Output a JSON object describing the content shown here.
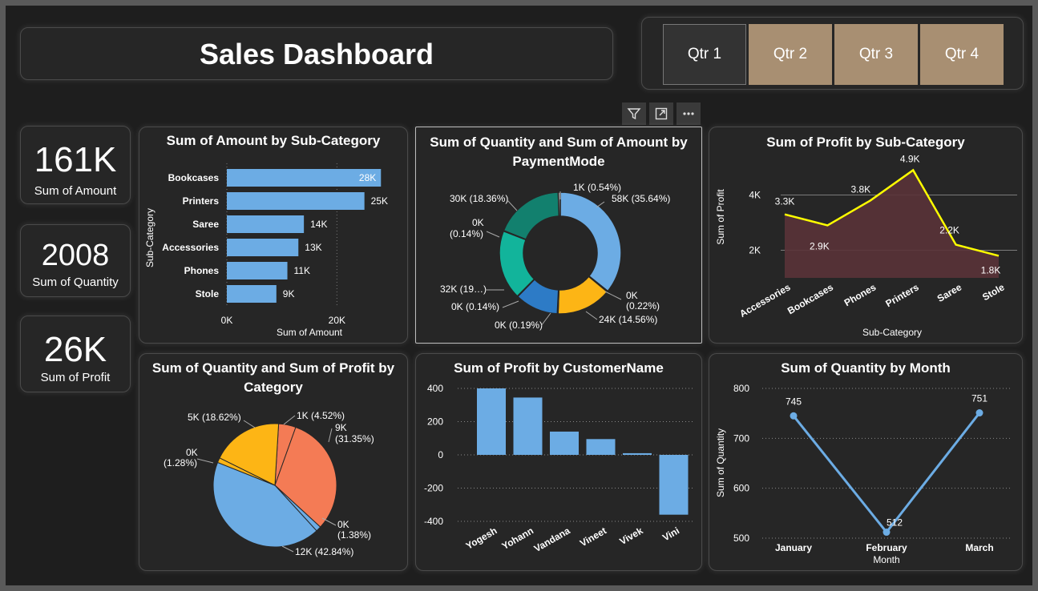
{
  "header": {
    "title": "Sales Dashboard"
  },
  "quarters": [
    {
      "label": "Qtr 1",
      "active": true
    },
    {
      "label": "Qtr 2",
      "active": false
    },
    {
      "label": "Qtr 3",
      "active": false
    },
    {
      "label": "Qtr 4",
      "active": false
    }
  ],
  "kpis": [
    {
      "value": "161K",
      "label": "Sum of Amount"
    },
    {
      "value": "2008",
      "label": "Sum of Quantity"
    },
    {
      "value": "26K",
      "label": "Sum of Profit"
    }
  ],
  "toolbar": {
    "filter_icon": "filter-icon",
    "focus_icon": "focus-mode-icon",
    "more_icon": "more-options-icon"
  },
  "colors": {
    "bar": "#6CACE4",
    "line_yellow": "#FFFF00",
    "area_fill": "#5a3338",
    "pie_blue": "#6CACE4",
    "pie_orange": "#F47B55",
    "pie_yellow": "#FDB515",
    "donut_teal_dark": "#12806E",
    "donut_teal": "#12B49B",
    "donut_blue": "#2D7BC6",
    "donut_yellow": "#FDB515",
    "qtr_inactive": "#a88f72"
  },
  "chart_data": [
    {
      "id": "amount_by_subcat",
      "type": "bar",
      "orientation": "horizontal",
      "title": "Sum of Amount by Sub-Category",
      "xlabel": "Sum of Amount",
      "ylabel": "Sub-Category",
      "categories": [
        "Bookcases",
        "Printers",
        "Saree",
        "Accessories",
        "Phones",
        "Stole"
      ],
      "values": [
        28000,
        25000,
        14000,
        13000,
        11000,
        9000
      ],
      "data_labels": [
        "28K",
        "25K",
        "14K",
        "13K",
        "11K",
        "9K"
      ],
      "xticks": [
        "0K",
        "20K"
      ],
      "xlim": [
        0,
        30000
      ]
    },
    {
      "id": "qty_amount_by_payment",
      "type": "pie",
      "variant": "donut",
      "title": "Sum of Quantity and Sum of Amount by PaymentMode",
      "slices": [
        {
          "value": 35.64,
          "label": "58K (35.64%)",
          "color": "#6CACE4"
        },
        {
          "value": 0.22,
          "label": "0K (0.22%)",
          "color": "#9a8a6a"
        },
        {
          "value": 14.56,
          "label": "24K (14.56%)",
          "color": "#FDB515"
        },
        {
          "value": 0.19,
          "label": "0K (0.19%)",
          "color": "#8a6fb0"
        },
        {
          "value": 11.5,
          "label": "",
          "color": "#2D7BC6"
        },
        {
          "value": 0.14,
          "label": "0K (0.14%)",
          "color": "#c0506a"
        },
        {
          "value": 18.36,
          "label": "32K (19…)",
          "color": "#12B49B"
        },
        {
          "value": 0.14,
          "label": "0K (0.14%)",
          "color": "#888888"
        },
        {
          "value": 18.36,
          "label": "30K (18.36%)",
          "color": "#12806E"
        },
        {
          "value": 0.54,
          "label": "1K (0.54%)",
          "color": "#aaaaaa"
        }
      ]
    },
    {
      "id": "profit_by_subcat",
      "type": "area",
      "title": "Sum of Profit by Sub-Category",
      "xlabel": "Sub-Category",
      "ylabel": "Sum of Profit",
      "categories": [
        "Accessories",
        "Bookcases",
        "Phones",
        "Printers",
        "Saree",
        "Stole"
      ],
      "values": [
        3300,
        2900,
        3800,
        4900,
        2200,
        1800
      ],
      "data_labels": [
        "3.3K",
        "2.9K",
        "3.8K",
        "4.9K",
        "2.2K",
        "1.8K"
      ],
      "yticks": [
        "2K",
        "4K"
      ],
      "ylim": [
        1000,
        5000
      ]
    },
    {
      "id": "qty_profit_by_category",
      "type": "pie",
      "title": "Sum of Quantity and Sum of Profit by Category",
      "slices": [
        {
          "value": 4.52,
          "label": "1K (4.52%)",
          "color": "#F47B55"
        },
        {
          "value": 31.35,
          "label": "9K (31.35%)",
          "color": "#F47B55"
        },
        {
          "value": 1.38,
          "label": "0K (1.38%)",
          "color": "#6CACE4"
        },
        {
          "value": 42.84,
          "label": "12K (42.84%)",
          "color": "#6CACE4"
        },
        {
          "value": 1.28,
          "label": "0K (1.28%)",
          "color": "#FDB515"
        },
        {
          "value": 18.62,
          "label": "5K (18.62%)",
          "color": "#FDB515"
        }
      ]
    },
    {
      "id": "profit_by_customer",
      "type": "bar",
      "title": "Sum of Profit by CustomerName",
      "categories": [
        "Yogesh",
        "Yohann",
        "Vandana",
        "Vineet",
        "Vivek",
        "Vini"
      ],
      "values": [
        400,
        345,
        140,
        95,
        10,
        -360
      ],
      "yticks": [
        "400",
        "200",
        "0",
        "-200",
        "-400"
      ],
      "ylim": [
        -400,
        400
      ]
    },
    {
      "id": "qty_by_month",
      "type": "line",
      "title": "Sum of Quantity by Month",
      "xlabel": "Month",
      "ylabel": "Sum of Quantity",
      "categories": [
        "January",
        "February",
        "March"
      ],
      "values": [
        745,
        512,
        751
      ],
      "data_labels": [
        "745",
        "512",
        "751"
      ],
      "yticks": [
        "800",
        "700",
        "600",
        "500"
      ],
      "ylim": [
        500,
        800
      ]
    }
  ]
}
